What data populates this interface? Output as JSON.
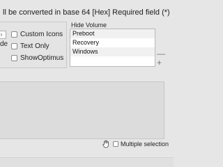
{
  "header": {
    "text": "ll be converted in base 64 [Hex]   Required field (*)"
  },
  "left_group": {
    "partial_label": "de"
  },
  "checkboxes": [
    {
      "label": "Custom Icons",
      "checked": false
    },
    {
      "label": "Text Only",
      "checked": false
    },
    {
      "label": "ShowOptimus",
      "checked": false
    }
  ],
  "hide_volume": {
    "label": "Hide Volume",
    "items": [
      "Preboot",
      "Recovery",
      "Windows"
    ],
    "minus": "—",
    "plus": "+"
  },
  "footer": {
    "hand_icon": "hand-pointer-icon",
    "multiple_selection_label": "Multiple selection",
    "multiple_selection_checked": false
  }
}
